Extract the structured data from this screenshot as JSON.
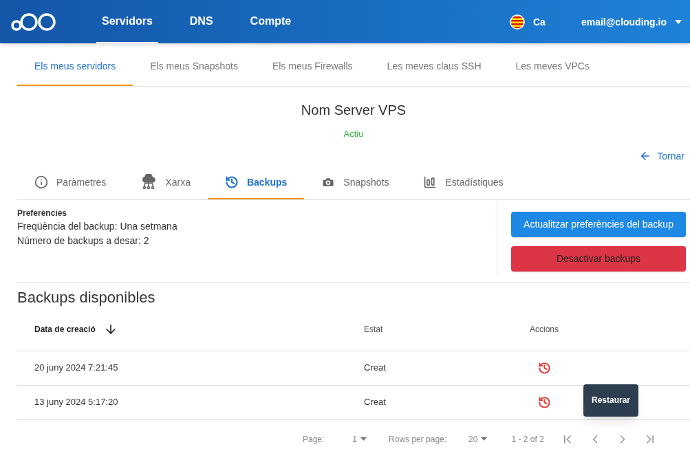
{
  "header": {
    "nav": [
      {
        "label": "Servidors",
        "selected": true
      },
      {
        "label": "DNS",
        "selected": false
      },
      {
        "label": "Compte",
        "selected": false
      }
    ],
    "language": "Ca",
    "account": "email@clouding.io"
  },
  "top_tabs": [
    {
      "label": "Els meus servidors",
      "selected": true
    },
    {
      "label": "Els meus Snapshots",
      "selected": false
    },
    {
      "label": "Els meus Firewalls",
      "selected": false
    },
    {
      "label": "Les meves claus SSH",
      "selected": false
    },
    {
      "label": "Les meves VPCs",
      "selected": false
    }
  ],
  "server": {
    "name": "Nom Server VPS",
    "status": "Actiu",
    "back": "Tornar"
  },
  "server_tabs": [
    {
      "label": "Paràmetres",
      "kind": "info",
      "selected": false
    },
    {
      "label": "Xarxa",
      "kind": "network",
      "selected": false
    },
    {
      "label": "Backups",
      "kind": "history",
      "selected": true
    },
    {
      "label": "Snapshots",
      "kind": "camera",
      "selected": false
    },
    {
      "label": "Estadístiques",
      "kind": "chart",
      "selected": false
    }
  ],
  "preferences": {
    "title": "Preferències",
    "lines": [
      "Freqüència del backup: Una setmana",
      "Número de backups a desar: 2"
    ],
    "update_button": "Actualitzar preferències del backup",
    "disable_button": "Desactivar backups"
  },
  "backups": {
    "title": "Backups disponibles",
    "columns": [
      "Data de creació",
      "Estat",
      "Accions"
    ],
    "rows": [
      {
        "date": "20 juny 2024 7:21:45",
        "status": "Creat"
      },
      {
        "date": "13 juny 2024 5:17:20",
        "status": "Creat"
      }
    ],
    "tooltip": "Restaurar"
  },
  "pagination": {
    "page_label": "Page:",
    "page": "1",
    "rows_label": "Rows per page:",
    "rows": "20",
    "range": "1 - 2 of 2"
  }
}
